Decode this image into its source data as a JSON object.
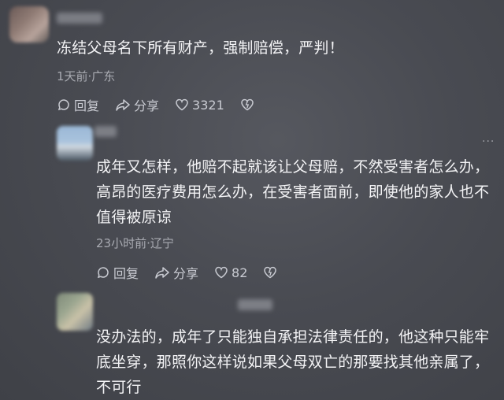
{
  "comments": [
    {
      "text": "冻结父母名下所有财产，强制赔偿，严判！",
      "meta": "1天前·广东",
      "reply_label": "回复",
      "share_label": "分享",
      "like_count": "3321"
    },
    {
      "text": "成年又怎样，他赔不起就该让父母赔，不然受害者怎么办，高昂的医疗费用怎么办，在受害者面前，即使他的家人也不值得被原谅",
      "meta": "23小时前·辽宁",
      "reply_label": "回复",
      "share_label": "分享",
      "like_count": "82",
      "more": "···"
    },
    {
      "text": "没办法的，成年了只能独自承担法律责任的，他这种只能牢底坐穿，那照你这样说如果父母双亡的那要找其他亲属了，不可行"
    }
  ],
  "icons": [
    "reply-icon",
    "share-icon",
    "heart-icon",
    "dislike-heart-icon",
    "more-icon"
  ]
}
